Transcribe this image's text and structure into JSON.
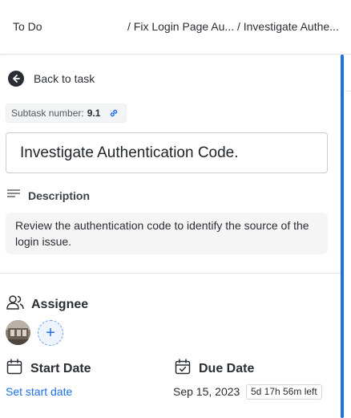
{
  "header": {
    "todo": "To Do",
    "breadcrumb": "/ Fix Login Page Au... / Investigate Authe..."
  },
  "back": {
    "label": "Back to task",
    "icon": "arrow-left-circle-icon"
  },
  "subtask": {
    "label": "Subtask number:",
    "number": "9.1",
    "icon": "link-icon"
  },
  "task": {
    "title": "Investigate Authentication Code."
  },
  "description": {
    "label": "Description",
    "icon": "lines-icon",
    "text": "Review the authentication code to identify the source of the login issue."
  },
  "assignee": {
    "label": "Assignee",
    "icon": "users-icon",
    "add_symbol": "+"
  },
  "start_date": {
    "label": "Start Date",
    "value": "Set start date",
    "icon": "calendar-icon"
  },
  "due_date": {
    "label": "Due Date",
    "value": "Sep 15, 2023",
    "remaining": "5d 17h 56m left",
    "icon": "calendar-check-icon"
  },
  "colors": {
    "accent": "#1f6fe5",
    "text": "#2a2e34",
    "muted_bg": "#f5f5f6"
  }
}
